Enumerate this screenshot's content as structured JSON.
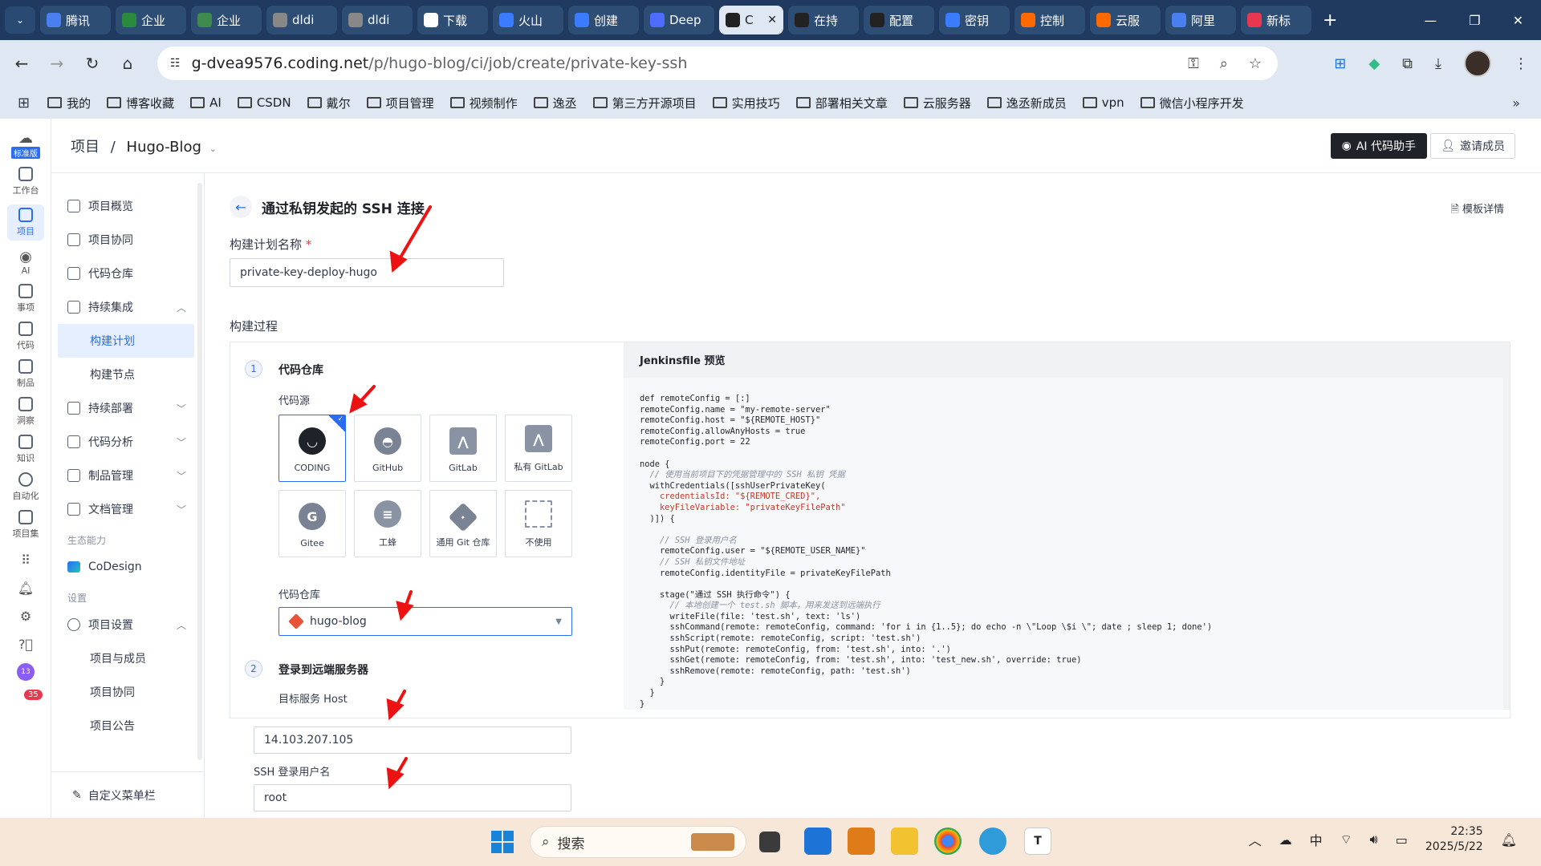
{
  "browser": {
    "tabs": [
      {
        "label": "腾讯",
        "color": "#4a7ff0"
      },
      {
        "label": "企业",
        "color": "#2c8a3f"
      },
      {
        "label": "企业",
        "color": "#3f8a4f"
      },
      {
        "label": "dldi",
        "color": "#888888"
      },
      {
        "label": "dldi",
        "color": "#888888"
      },
      {
        "label": "下载",
        "color": "#ffffff"
      },
      {
        "label": "火山",
        "color": "#3a7bff"
      },
      {
        "label": "创建",
        "color": "#3a7bff"
      },
      {
        "label": "Deep",
        "color": "#4d6bfe"
      },
      {
        "label": "C",
        "color": "#222222",
        "active": true
      },
      {
        "label": "在持",
        "color": "#222222"
      },
      {
        "label": "配置",
        "color": "#222222"
      },
      {
        "label": "密钥",
        "color": "#3a7bff"
      },
      {
        "label": "控制",
        "color": "#ff6a00"
      },
      {
        "label": "云服",
        "color": "#ff6a00"
      },
      {
        "label": "阿里",
        "color": "#4a7ff0"
      },
      {
        "label": "新标",
        "color": "#e8384f"
      }
    ],
    "url_host": "g-dvea9576.coding.net",
    "url_path": "/p/hugo-blog/ci/job/create/private-key-ssh",
    "bookmarks": [
      "我的",
      "博客收藏",
      "AI",
      "CSDN",
      "戴尔",
      "项目管理",
      "视频制作",
      "逸丞",
      "第三方开源项目",
      "实用技巧",
      "部署相关文章",
      "云服务器",
      "逸丞新成员",
      "vpn",
      "微信小程序开发"
    ]
  },
  "rail": {
    "items": [
      "标准版",
      "工作台",
      "项目",
      "AI",
      "事项",
      "代码",
      "制品",
      "洞察",
      "知识",
      "自动化",
      "项目集"
    ],
    "badge": "35",
    "avatar_text": "13"
  },
  "header": {
    "crumb_root": "项目",
    "crumb_sep": "/",
    "crumb_project": "Hugo-Blog",
    "ai_button": "AI 代码助手",
    "invite_button": "邀请成员"
  },
  "sidebar": {
    "items": [
      "项目概览",
      "项目协同",
      "代码仓库",
      "持续集成"
    ],
    "ci_sub": [
      "构建计划",
      "构建节点"
    ],
    "items2": [
      "持续部署",
      "代码分析",
      "制品管理",
      "文档管理"
    ],
    "group_eco": "生态能力",
    "codesign": "CoDesign",
    "group_settings": "设置",
    "settings": "项目设置",
    "settings_sub": [
      "项目与成员",
      "项目协同",
      "项目公告"
    ],
    "footer": "自定义菜单栏"
  },
  "form": {
    "title": "通过私钥发起的 SSH 连接",
    "template_link": "模板详情",
    "name_label": "构建计划名称",
    "name_value": "private-key-deploy-hugo",
    "process_label": "构建过程",
    "step1": {
      "num": "1",
      "title": "代码仓库",
      "source_label": "代码源"
    },
    "sources": [
      "CODING",
      "GitHub",
      "GitLab",
      "私有 GitLab",
      "Gitee",
      "工蜂",
      "通用 Git 仓库",
      "不使用"
    ],
    "repo_label": "代码仓库",
    "repo_value": "hugo-blog",
    "step2": {
      "num": "2",
      "title": "登录到远端服务器"
    },
    "host_label": "目标服务 Host",
    "host_value": "14.103.207.105",
    "user_label": "SSH 登录用户名",
    "user_value": "root"
  },
  "jenkins": {
    "title": "Jenkinsfile 预览",
    "lines": [
      "def remoteConfig = [:]",
      "remoteConfig.name = \"my-remote-server\"",
      "remoteConfig.host = \"${REMOTE_HOST}\"",
      "remoteConfig.allowAnyHosts = true",
      "remoteConfig.port = 22",
      "",
      "node {",
      "  // 使用当前项目下的凭据管理中的 SSH 私钥 凭据",
      "  withCredentials([sshUserPrivateKey(",
      "    credentialsId: \"${REMOTE_CRED}\",",
      "    keyFileVariable: \"privateKeyFilePath\"",
      "  )]) {",
      "",
      "    // SSH 登录用户名",
      "    remoteConfig.user = \"${REMOTE_USER_NAME}\"",
      "    // SSH 私钥文件地址",
      "    remoteConfig.identityFile = privateKeyFilePath",
      "",
      "    stage(\"通过 SSH 执行命令\") {",
      "      // 本地创建一个 test.sh 脚本，用来发送到远端执行",
      "      writeFile(file: 'test.sh', text: 'ls')",
      "      sshCommand(remote: remoteConfig, command: 'for i in {1..5}; do echo -n \\\"Loop \\$i \\\"; date ; sleep 1; done')",
      "      sshScript(remote: remoteConfig, script: 'test.sh')",
      "      sshPut(remote: remoteConfig, from: 'test.sh', into: '.')",
      "      sshGet(remote: remoteConfig, from: 'test.sh', into: 'test_new.sh', override: true)",
      "      sshRemove(remote: remoteConfig, path: 'test.sh')",
      "    }",
      "  }",
      "}"
    ]
  },
  "taskbar": {
    "search_placeholder": "搜索",
    "ime": "中",
    "time": "22:35",
    "date": "2025/5/22"
  },
  "colors": {
    "accent": "#2a6df4",
    "arrow": "#ee1111",
    "tabbar": "#1f3a5e",
    "chrome": "#dfe7f3"
  }
}
